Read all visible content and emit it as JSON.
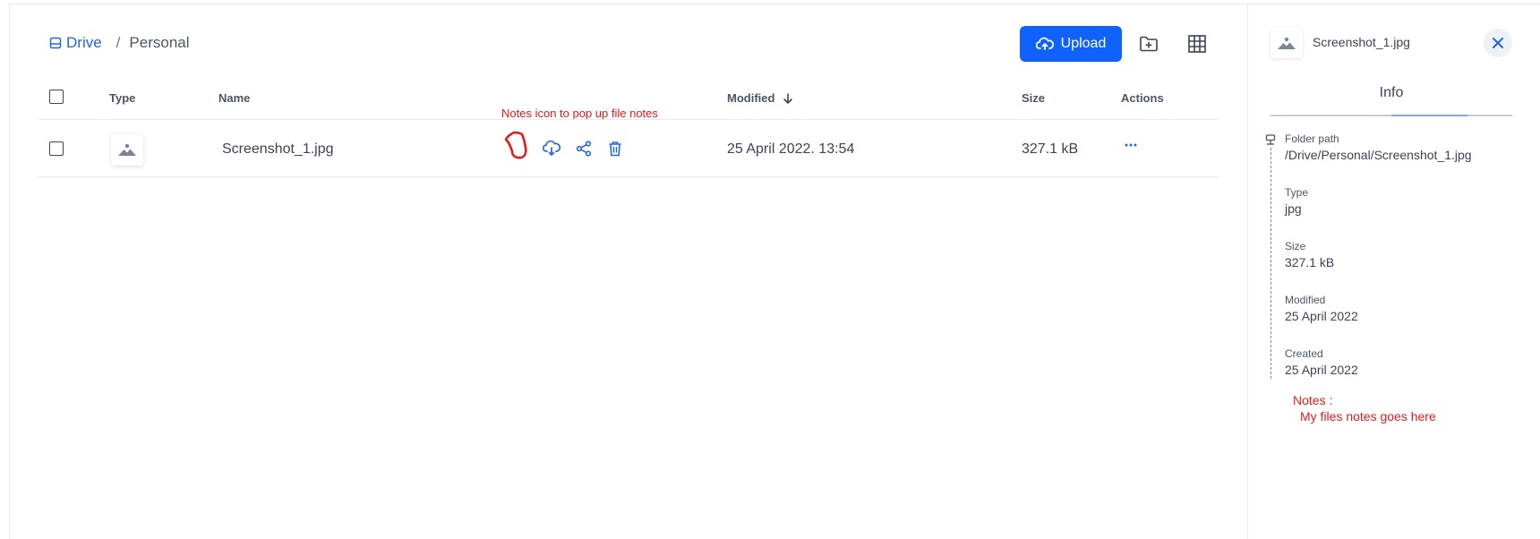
{
  "breadcrumb": {
    "root": "Drive",
    "separator": "/",
    "current": "Personal"
  },
  "toolbar": {
    "upload_label": "Upload",
    "new_folder_icon": "folder-plus-icon",
    "grid_view_icon": "grid-view-icon"
  },
  "table": {
    "headers": {
      "type": "Type",
      "name": "Name",
      "modified": "Modified",
      "size": "Size",
      "actions": "Actions"
    },
    "sort": {
      "column": "Modified",
      "direction": "descending"
    },
    "rows": [
      {
        "name": "Screenshot_1.jpg",
        "type_icon": "image-icon",
        "modified": "25 April 2022. 13:54",
        "size": "327.1 kB"
      }
    ]
  },
  "annotations": {
    "note": "Notes icon to pop up file notes",
    "color": "#e11b1b"
  },
  "panel": {
    "file_name": "Screenshot_1.jpg",
    "tab_label": "Info",
    "fields": [
      {
        "label": "Folder path",
        "value": "/Drive/Personal/Screenshot_1.jpg"
      },
      {
        "label": "Type",
        "value": "jpg"
      },
      {
        "label": "Size",
        "value": "327.1 kB"
      },
      {
        "label": "Modified",
        "value": "25 April 2022"
      },
      {
        "label": "Created",
        "value": "25 April 2022"
      }
    ],
    "notes_label": "Notes :",
    "notes_value": "My files notes goes here"
  },
  "colors": {
    "accent": "#0f62fe",
    "link": "#2266e0",
    "annotation": "#e11b1b"
  }
}
